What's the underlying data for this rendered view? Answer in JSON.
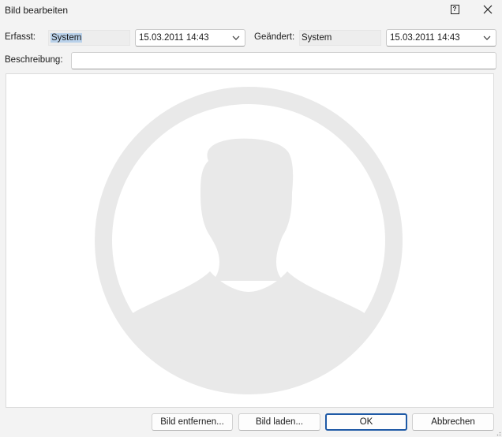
{
  "window": {
    "title": "Bild bearbeiten",
    "help_icon": "question-mark-box-icon",
    "close_icon": "close-x-icon"
  },
  "fields": {
    "created_label": "Erfasst:",
    "created_by": "System",
    "created_date": "15.03.2011 14:43",
    "changed_label": "Geändert:",
    "changed_by": "System",
    "changed_date": "15.03.2011 14:43",
    "description_label": "Beschreibung:",
    "description_value": ""
  },
  "image": {
    "placeholder_icon": "person-silhouette-placeholder-icon"
  },
  "buttons": {
    "remove_image": "Bild entfernen...",
    "load_image": "Bild laden...",
    "ok": "OK",
    "cancel": "Abbrechen"
  },
  "colors": {
    "accent": "#1f5aa6",
    "selection": "#b9d1ea",
    "placeholder_gray": "#e9e9e9"
  }
}
